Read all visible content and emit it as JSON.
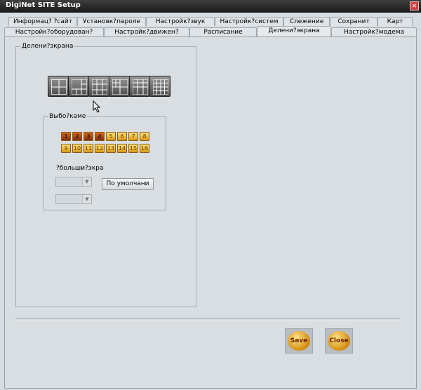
{
  "window": {
    "title": "DigiNet SITE Setup"
  },
  "tabs_row1": [
    "Информац? ?сайт",
    "Установк?пароле",
    "Настройк?звук",
    "Настройк?систем",
    "Слежение",
    "Сохранит",
    "Карт"
  ],
  "tabs_row2": [
    "Настройк?оборудован?",
    "Настройк?движен?",
    "Расписание",
    "Делени?экрана",
    "Настройк?модема"
  ],
  "active_tab": "Делени?экрана",
  "split_group": {
    "legend": "Делени?экрана"
  },
  "camera_group": {
    "legend": "Выбо?каме",
    "row1": [
      "1",
      "2",
      "3",
      "4",
      "5",
      "6",
      "7",
      "8"
    ],
    "row2": [
      "9",
      "10",
      "11",
      "12",
      "13",
      "14",
      "15",
      "16"
    ],
    "zoom_label": "?больши?экра",
    "default_button": "По умолчани"
  },
  "buttons": {
    "save": "Save",
    "close": "Close"
  },
  "icons": {
    "close": "×",
    "dropdown": "▼"
  }
}
